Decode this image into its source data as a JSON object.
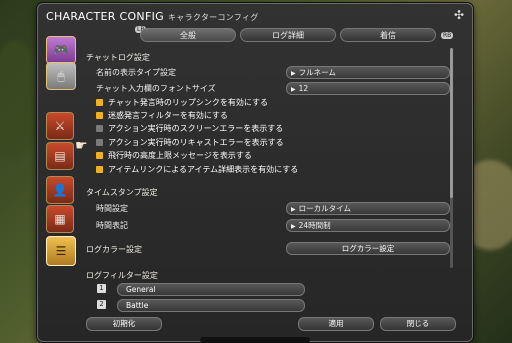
{
  "window": {
    "title": "CHARACTER CONFIG",
    "title_sub": "キャラクターコンフィグ",
    "tab_lb": "LB",
    "tab_rb": "RB"
  },
  "tabs": [
    {
      "label": "全般"
    },
    {
      "label": "ログ詳細"
    },
    {
      "label": "着信"
    }
  ],
  "side_icons": [
    "gamepad-icon",
    "mouse-icon",
    "crossed-swords-icon",
    "chat-window-icon",
    "character-icon",
    "target-icon",
    "chat-log-icon"
  ],
  "chat_log": {
    "header": "チャットログ設定",
    "name_type_label": "名前の表示タイプ設定",
    "name_type_value": "フルネーム",
    "font_size_label": "チャット入力欄のフォントサイズ",
    "font_size_value": "12",
    "checkboxes": [
      {
        "label": "チャット発言時のリップシンクを有効にする",
        "checked": true
      },
      {
        "label": "迷惑発言フィルターを有効にする",
        "checked": true
      },
      {
        "label": "アクション実行時のスクリーンエラーを表示する",
        "checked": false
      },
      {
        "label": "アクション実行時のリキャストエラーを表示する",
        "checked": false
      },
      {
        "label": "飛行時の高度上限メッセージを表示する",
        "checked": true
      },
      {
        "label": "アイテムリンクによるアイテム詳細表示を有効にする",
        "checked": true
      }
    ]
  },
  "timestamp": {
    "header": "タイムスタンプ設定",
    "time_setting_label": "時間設定",
    "time_setting_value": "ローカルタイム",
    "time_format_label": "時間表記",
    "time_format_value": "24時間制"
  },
  "log_color": {
    "header": "ログカラー設定",
    "button": "ログカラー設定"
  },
  "log_filter": {
    "header": "ログフィルター設定",
    "items": [
      {
        "key": "1",
        "label": "General"
      },
      {
        "key": "2",
        "label": "Battle"
      }
    ]
  },
  "footer": {
    "reset": "初期化",
    "apply": "適用",
    "close": "閉じる"
  },
  "colors": {
    "accent_checkbox": "#f0b020",
    "side_active": "#8a4aa0"
  }
}
